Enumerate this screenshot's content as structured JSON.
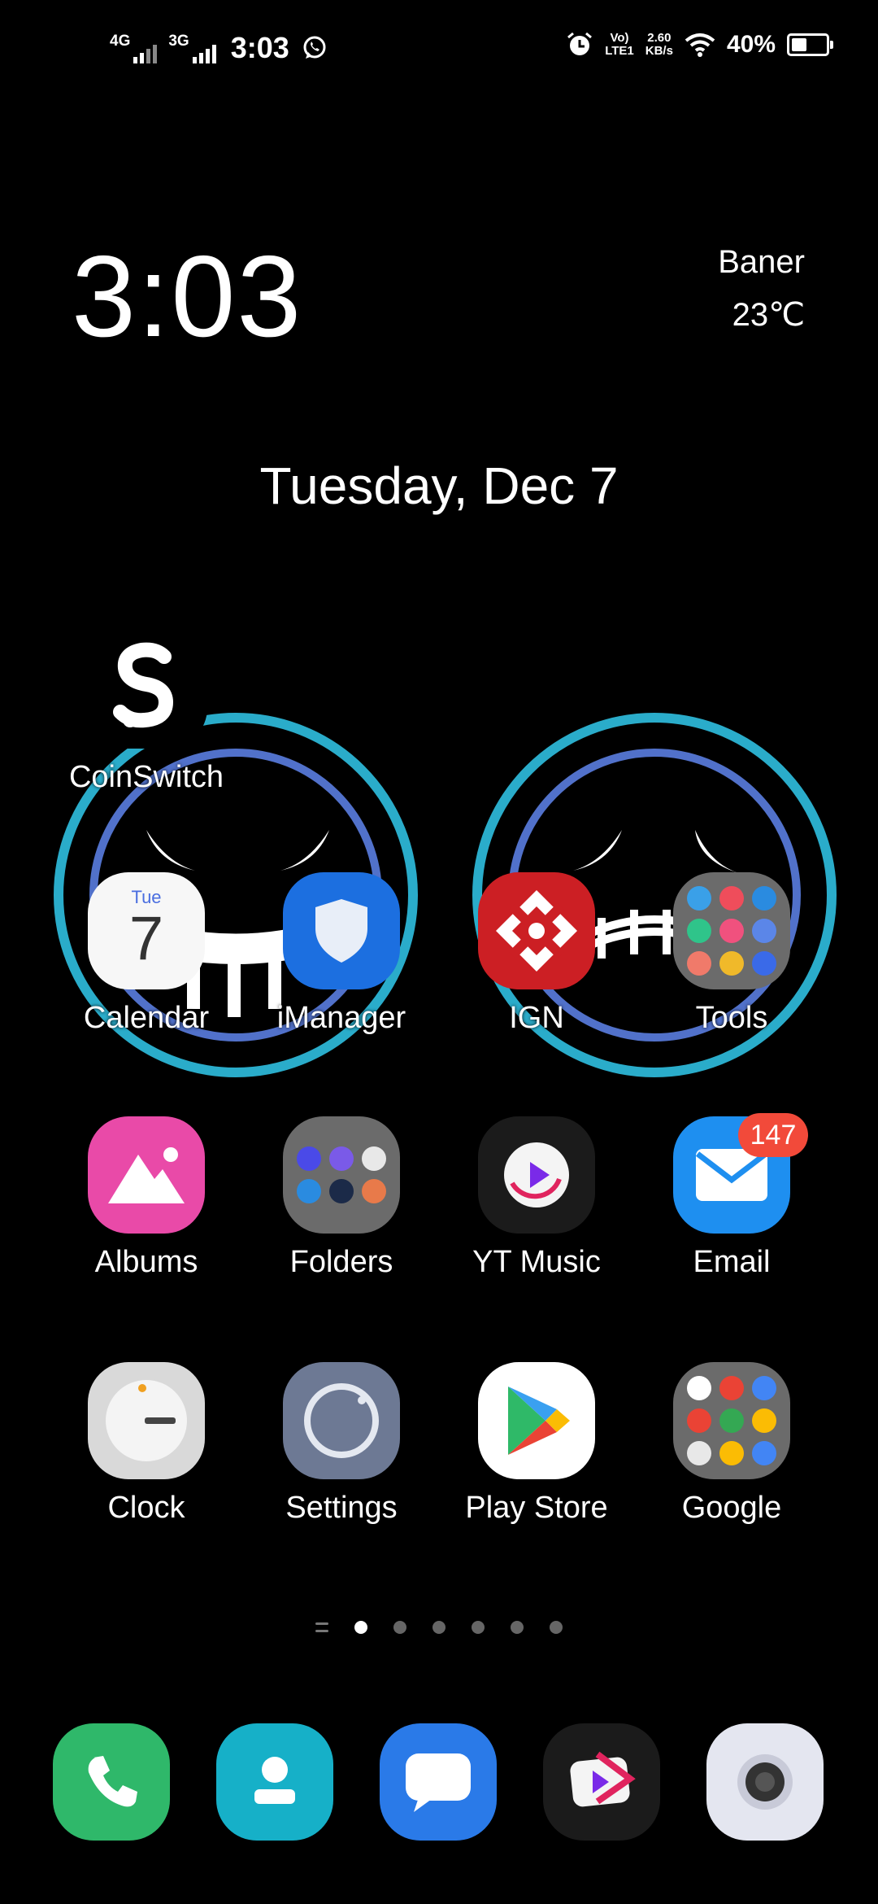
{
  "status_bar": {
    "network_1": "4G",
    "network_2": "3G",
    "time": "3:03",
    "volte": "Vo)",
    "volte_sub": "LTE1",
    "speed": "2.60",
    "speed_unit": "KB/s",
    "battery": "40%",
    "battery_level": 0.4,
    "icons": [
      "whatsapp-icon",
      "alarm-icon",
      "wifi-icon",
      "battery-icon"
    ]
  },
  "clock_widget": {
    "time": "3:03",
    "city": "Baner",
    "temperature": "23℃",
    "date": "Tuesday, Dec 7"
  },
  "apps": {
    "coinswitch": "CoinSwitch",
    "calendar": "Calendar",
    "calendar_day": "Tue",
    "calendar_date": "7",
    "imanager": "iManager",
    "ign": "IGN",
    "tools": "Tools",
    "albums": "Albums",
    "folders": "Folders",
    "yt_music": "YT Music",
    "email": "Email",
    "email_badge": "147",
    "clock": "Clock",
    "settings": "Settings",
    "play_store": "Play Store",
    "google": "Google"
  },
  "pager": {
    "pages": 6,
    "active_index": 0
  },
  "dock": [
    "phone-icon",
    "contacts-icon",
    "messages-icon",
    "video-icon",
    "camera-icon"
  ],
  "colors": {
    "background": "#000000",
    "badge": "#f24a3a",
    "ring": "#32c8e6"
  }
}
